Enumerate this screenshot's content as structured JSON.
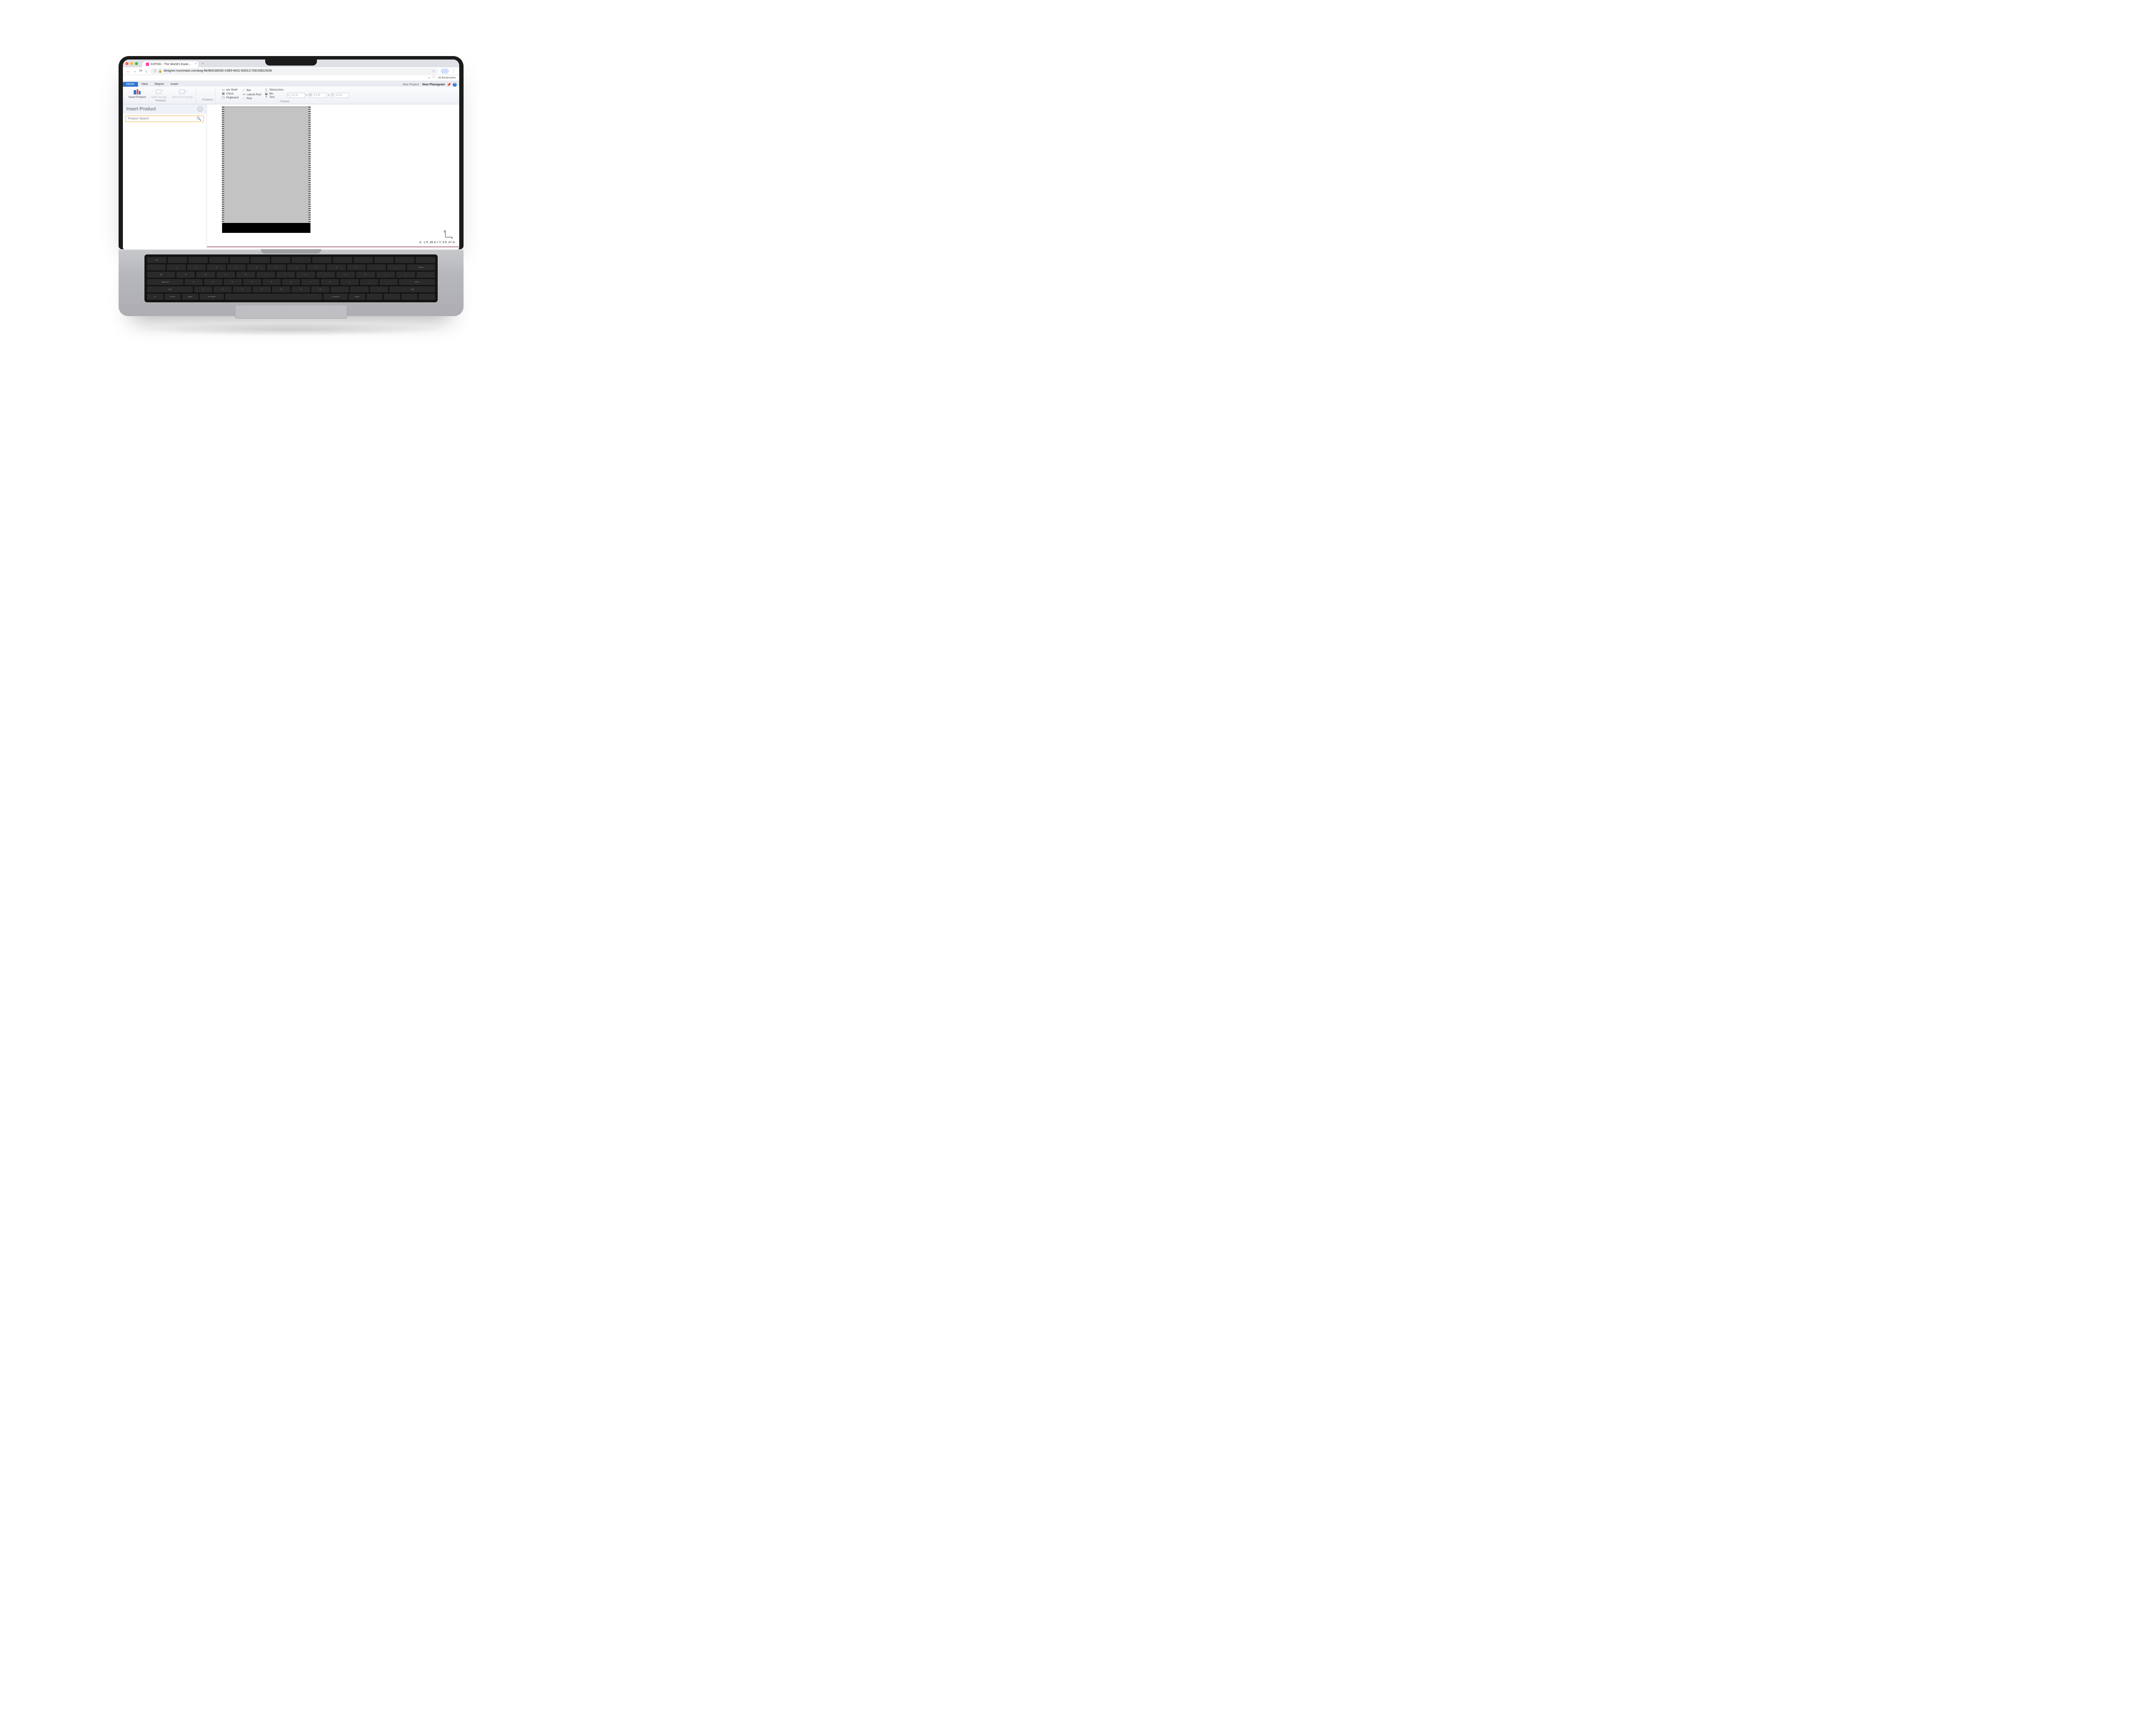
{
  "browser": {
    "tab_title": "EZPOG - The World's Easie…",
    "url_display": "designer.myomnipix.com/pog-file/B0D38D5D-C8E9-6831-B3DCC7DE20B225DB",
    "bookmarks_label": "All Bookmarks"
  },
  "app": {
    "tabs": [
      "Home",
      "View",
      "Report",
      "Insert"
    ],
    "active_tab": "Home",
    "project_prefix": "New Project - ",
    "project_name": "New Planogram"
  },
  "ribbon": {
    "products": {
      "insert_product": "Insert Product",
      "add_facings": "Add Facings",
      "remove_facings": "Remove Facings",
      "group": "Products"
    },
    "positions": {
      "group": "Positions"
    },
    "fixtures": {
      "group": "Fixtures",
      "col1": [
        "e/e Shelf",
        "Chest",
        "Pegboard"
      ],
      "col2": [
        "Bar",
        "Lateral Rod",
        "Rod"
      ],
      "col3": [
        "Obstruction",
        "Bin",
        "Text"
      ]
    },
    "dims": {
      "labels": [
        "L",
        "W",
        "H"
      ],
      "l": "0.0 in",
      "w": "0.0 in",
      "h": "0.0 in"
    }
  },
  "side": {
    "title": "Insert Product",
    "search_placeholder": "Product Search"
  },
  "canvas": {
    "axis_y": "y",
    "axis_x": "x",
    "coord": "X: -1 ft .35 in • Y: 6 ft .47 in"
  },
  "keys": {
    "r1": [
      "esc",
      "",
      "",
      "",
      "",
      "",
      "",
      "",
      "",
      "",
      "",
      "",
      "",
      ""
    ],
    "r2": [
      "`",
      "1",
      "2",
      "3",
      "4",
      "5",
      "6",
      "7",
      "8",
      "9",
      "0",
      "-",
      "=",
      "delete"
    ],
    "r3": [
      "tab",
      "Q",
      "W",
      "E",
      "R",
      "T",
      "Y",
      "U",
      "I",
      "O",
      "P",
      "[",
      "]",
      "\\"
    ],
    "r4": [
      "caps lock",
      "A",
      "S",
      "D",
      "F",
      "G",
      "H",
      "J",
      "K",
      "L",
      ";",
      "'",
      "return"
    ],
    "r5": [
      "shift",
      "Z",
      "X",
      "C",
      "V",
      "B",
      "N",
      "M",
      ",",
      ".",
      "/",
      "shift"
    ],
    "r6": [
      "fn",
      "control",
      "option",
      "command",
      "",
      "command",
      "option",
      "",
      "",
      "",
      ""
    ]
  }
}
